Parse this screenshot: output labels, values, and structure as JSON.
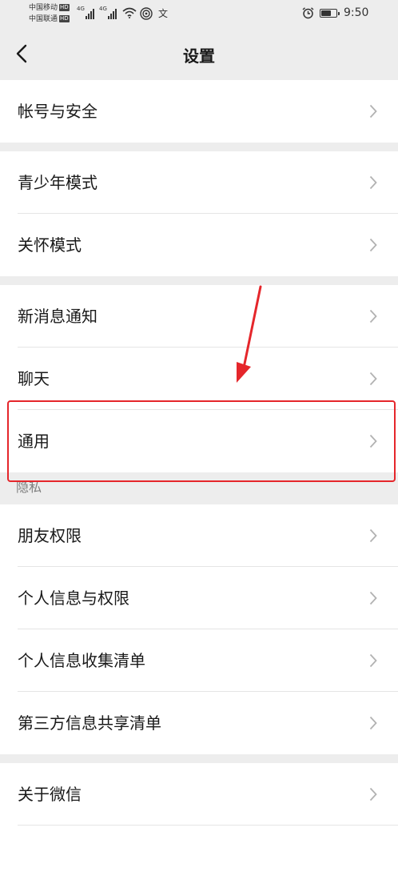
{
  "status_bar": {
    "carrier_1": "中国移动",
    "carrier_2": "中国联通",
    "hd": "HD",
    "network_1": "4G",
    "network_2": "4G",
    "misc_glyph": "文",
    "time": "9:50",
    "battery_level": 0.6,
    "icons": [
      "signal-icon",
      "wifi-icon",
      "hotspot-icon",
      "alarm-icon",
      "battery-icon"
    ]
  },
  "header": {
    "title": "设置",
    "back_icon": "chevron-left-icon"
  },
  "groups": [
    {
      "items": [
        {
          "label": "帐号与安全"
        }
      ]
    },
    {
      "items": [
        {
          "label": "青少年模式"
        },
        {
          "label": "关怀模式"
        }
      ]
    },
    {
      "items": [
        {
          "label": "新消息通知"
        },
        {
          "label": "聊天"
        },
        {
          "label": "通用"
        }
      ]
    },
    {
      "section_label": "隐私",
      "items": [
        {
          "label": "朋友权限"
        },
        {
          "label": "个人信息与权限"
        },
        {
          "label": "个人信息收集清单"
        },
        {
          "label": "第三方信息共享清单"
        }
      ]
    },
    {
      "items": [
        {
          "label": "关于微信"
        }
      ]
    }
  ],
  "colors": {
    "background": "#ededed",
    "row_background": "#ffffff",
    "text": "#191919",
    "section_text": "#7f7f7f",
    "chevron": "#b2b2b2",
    "annotation_red": "#e5262b"
  }
}
